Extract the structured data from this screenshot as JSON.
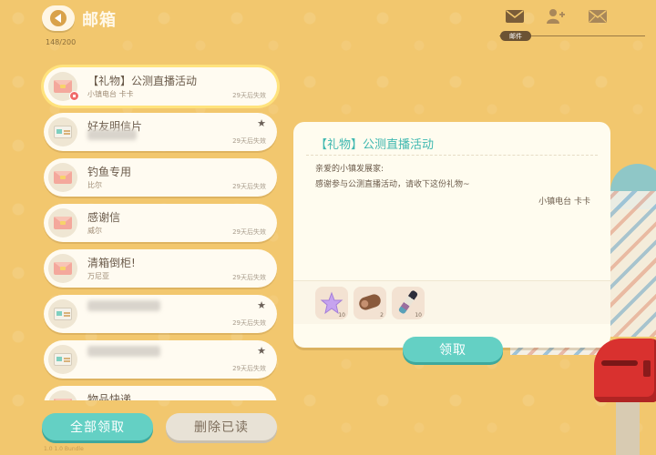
{
  "header": {
    "title": "邮箱",
    "count": "148/200"
  },
  "tabs": {
    "active_label": "邮件"
  },
  "mails": [
    {
      "title": "【礼物】公测直播活动",
      "sender": "小镇电台 卡卡",
      "expire": "29天后失效",
      "icon": "gift-envelope",
      "selected": true
    },
    {
      "title": "好友明信片",
      "sender": "",
      "expire": "29天后失效",
      "icon": "postcard",
      "starred": true
    },
    {
      "title": "钓鱼专用",
      "sender": "比尔",
      "expire": "29天后失效",
      "icon": "envelope"
    },
    {
      "title": "感谢信",
      "sender": "威尔",
      "expire": "29天后失效",
      "icon": "envelope"
    },
    {
      "title": "清箱倒柜!",
      "sender": "万尼亚",
      "expire": "29天后失效",
      "icon": "envelope"
    },
    {
      "title": "",
      "sender": "",
      "expire": "29天后失效",
      "icon": "postcard",
      "starred": true
    },
    {
      "title": "",
      "sender": "",
      "expire": "29天后失效",
      "icon": "postcard",
      "starred": true
    },
    {
      "title": "物品快递",
      "sender": "",
      "expire": "",
      "icon": "envelope"
    }
  ],
  "buttons": {
    "claim_all": "全部领取",
    "delete_read": "删除已读",
    "claim": "领取"
  },
  "detail": {
    "title": "【礼物】公测直播活动",
    "greeting": "亲爱的小镇发展家:",
    "body": "感谢参与公测直播活动，请收下这份礼物~",
    "signature": "小镇电台 卡卡",
    "attachments": [
      {
        "name": "purple-star-item",
        "count": "10"
      },
      {
        "name": "wood-log-item",
        "count": "2"
      },
      {
        "name": "paint-tube-item",
        "count": "10"
      }
    ]
  },
  "footer": {
    "text": "1.0 1.0 Bundle"
  },
  "colors": {
    "background": "#f2c76e",
    "accent": "#64d0c4",
    "title_teal": "#3fb8b0"
  }
}
